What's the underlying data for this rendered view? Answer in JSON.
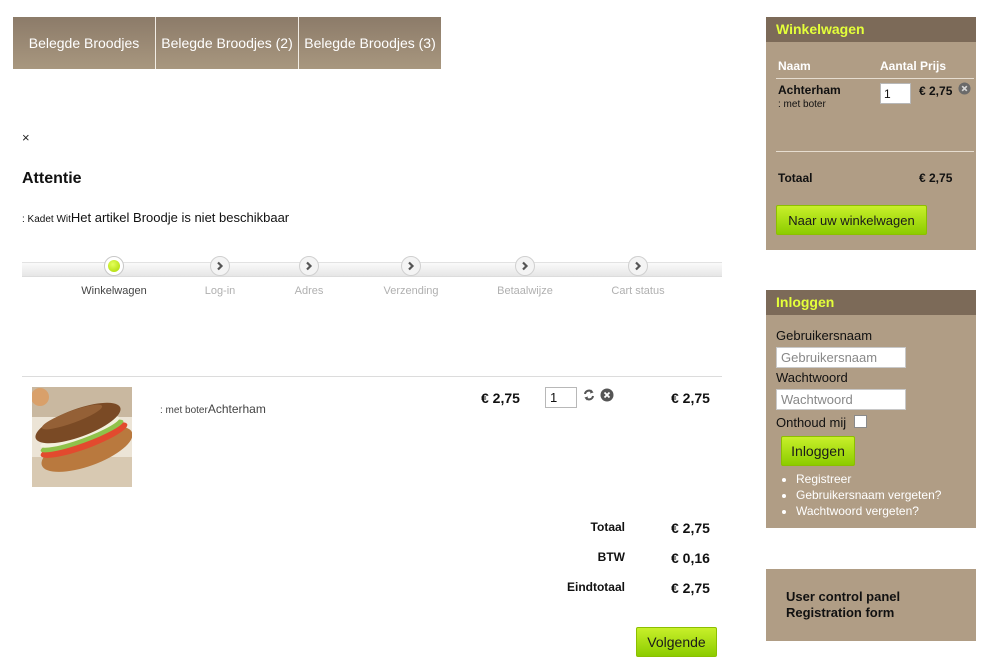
{
  "tabs": [
    "Belegde Broodjes",
    "Belegde Broodjes (2)",
    "Belegde Broodjes (3)"
  ],
  "alert": {
    "close": "×",
    "title": "Attentie",
    "prefix": ": Kadet Wit",
    "message": "Het artikel Broodje is niet beschikbaar"
  },
  "steps": [
    {
      "label": "Winkelwagen",
      "state": "current"
    },
    {
      "label": "Log-in",
      "state": "pending"
    },
    {
      "label": "Adres",
      "state": "pending"
    },
    {
      "label": "Verzending",
      "state": "pending"
    },
    {
      "label": "Betaalwijze",
      "state": "pending"
    },
    {
      "label": "Cart status",
      "state": "pending"
    }
  ],
  "product": {
    "option": ": met boter",
    "name": "Achterham",
    "price": "€ 2,75",
    "quantity": "1",
    "total": "€ 2,75"
  },
  "totals": [
    {
      "label": "Totaal",
      "value": "€ 2,75"
    },
    {
      "label": "BTW",
      "value": "€ 0,16"
    },
    {
      "label": "Eindtotaal",
      "value": "€ 2,75"
    }
  ],
  "next_button": "Volgende",
  "cart_box": {
    "title": "Winkelwagen",
    "col_name": "Naam",
    "col_qty": "Aantal",
    "col_price": "Prijs",
    "item_name": "Achterham",
    "item_option": ": met boter",
    "item_qty": "1",
    "item_price": "€ 2,75",
    "total_label": "Totaal",
    "total_value": "€ 2,75",
    "button": "Naar uw winkelwagen"
  },
  "login_box": {
    "title": "Inloggen",
    "username_label": "Gebruikersnaam",
    "username_placeholder": "Gebruikersnaam",
    "password_label": "Wachtwoord",
    "password_placeholder": "Wachtwoord",
    "remember_label": "Onthoud mij",
    "button": "Inloggen",
    "links": [
      "Registreer",
      "Gebruikersnaam vergeten?",
      "Wachtwoord vergeten?"
    ]
  },
  "panel_box": {
    "links": [
      "User control panel",
      "Registration form"
    ]
  },
  "colors": {
    "tab_bg": "#9a8975",
    "sidebar_bg": "#b09d85",
    "sidebar_head_bg": "#7c6a58",
    "sidebar_head_text": "#e4ff3a",
    "button_green": "#a8e010"
  }
}
